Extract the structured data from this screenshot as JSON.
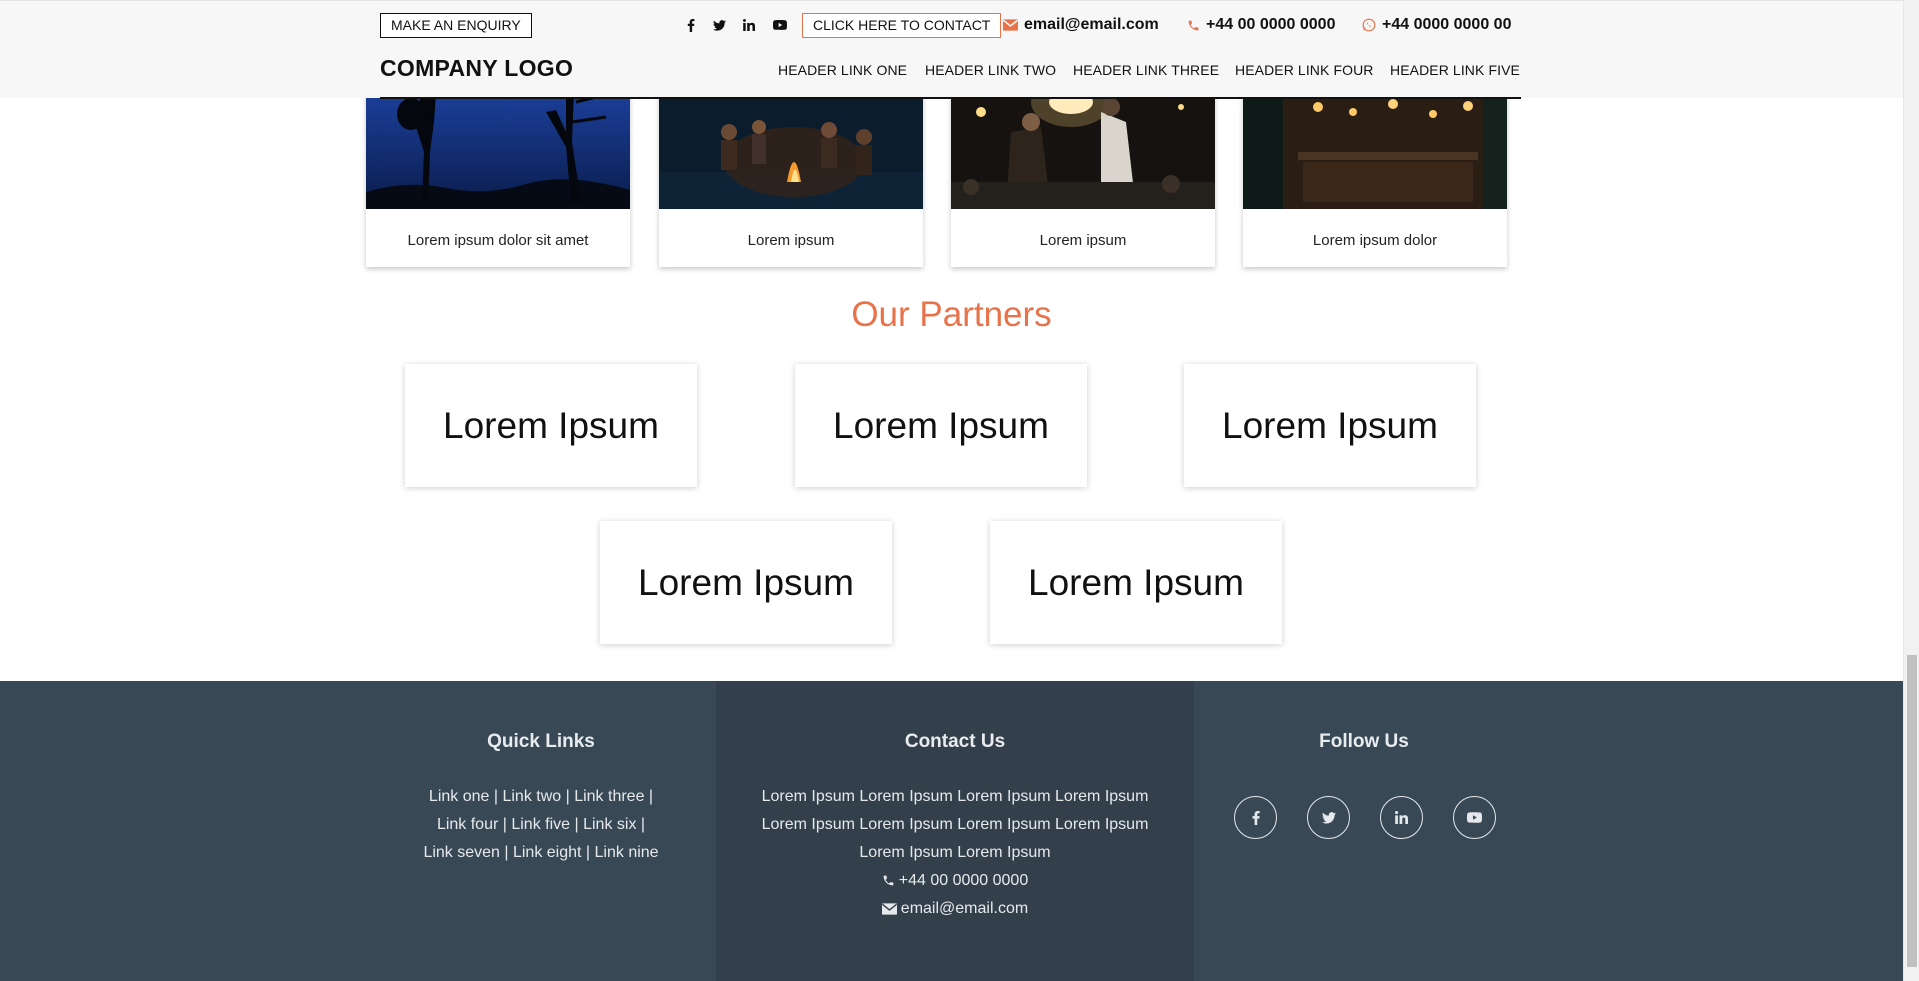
{
  "header": {
    "enquiry_label": "MAKE AN ENQUIRY",
    "contact_label": "CLICK HERE TO CONTACT",
    "email": "email@email.com",
    "phone": "+44 00 0000 0000",
    "whatsapp": "+44 0000 0000 00",
    "logo": "COMPANY LOGO",
    "social_icons": [
      "facebook-icon",
      "twitter-icon",
      "linkedin-icon",
      "youtube-icon"
    ],
    "nav": [
      "HEADER LINK ONE",
      "HEADER LINK TWO",
      "HEADER LINK THREE",
      "HEADER LINK FOUR",
      "HEADER LINK FIVE"
    ],
    "accent_color": "#e8734a"
  },
  "gallery": [
    {
      "caption": "Lorem ipsum dolor sit amet"
    },
    {
      "caption": "Lorem ipsum"
    },
    {
      "caption": "Lorem ipsum"
    },
    {
      "caption": "Lorem ipsum dolor"
    }
  ],
  "partners": {
    "title": "Our Partners",
    "items": [
      "Lorem Ipsum",
      "Lorem Ipsum",
      "Lorem Ipsum",
      "Lorem Ipsum",
      "Lorem Ipsum"
    ]
  },
  "footer": {
    "background": "#384855",
    "quick_links": {
      "title": "Quick Links",
      "lines": [
        "Link one | Link two | Link three |",
        "Link four | Link five | Link six |",
        "Link seven | Link eight | Link nine"
      ]
    },
    "contact": {
      "title": "Contact Us",
      "lines": [
        "Lorem Ipsum Lorem Ipsum Lorem Ipsum Lorem Ipsum",
        "Lorem Ipsum Lorem Ipsum Lorem Ipsum Lorem Ipsum",
        "Lorem Ipsum Lorem Ipsum"
      ],
      "phone": "+44 00 0000 0000",
      "email": "email@email.com"
    },
    "follow": {
      "title": "Follow Us",
      "icons": [
        "facebook-icon",
        "twitter-icon",
        "linkedin-icon",
        "youtube-icon"
      ]
    }
  }
}
